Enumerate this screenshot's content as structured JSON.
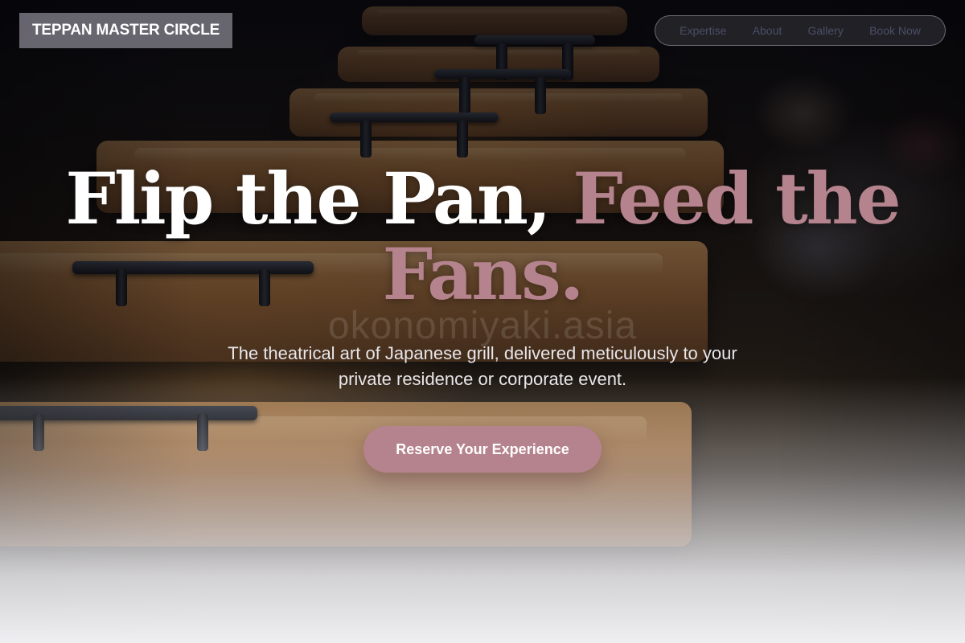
{
  "header": {
    "brand": "TEPPAN MASTER CIRCLE",
    "nav": [
      {
        "label": "Expertise"
      },
      {
        "label": "About"
      },
      {
        "label": "Gallery"
      },
      {
        "label": "Book Now"
      }
    ]
  },
  "hero": {
    "headline_part1": "Flip the Pan, ",
    "headline_accent": "Feed the Fans.",
    "watermark": "okonomiyaki.asia",
    "subtitle": "The theatrical art of Japanese grill, delivered meticulously to your private residence or corporate event.",
    "cta_label": "Reserve Your Experience"
  },
  "colors": {
    "accent": "#b5838d",
    "brand_bg": "#78767f",
    "nav_text": "#4b4f66"
  }
}
